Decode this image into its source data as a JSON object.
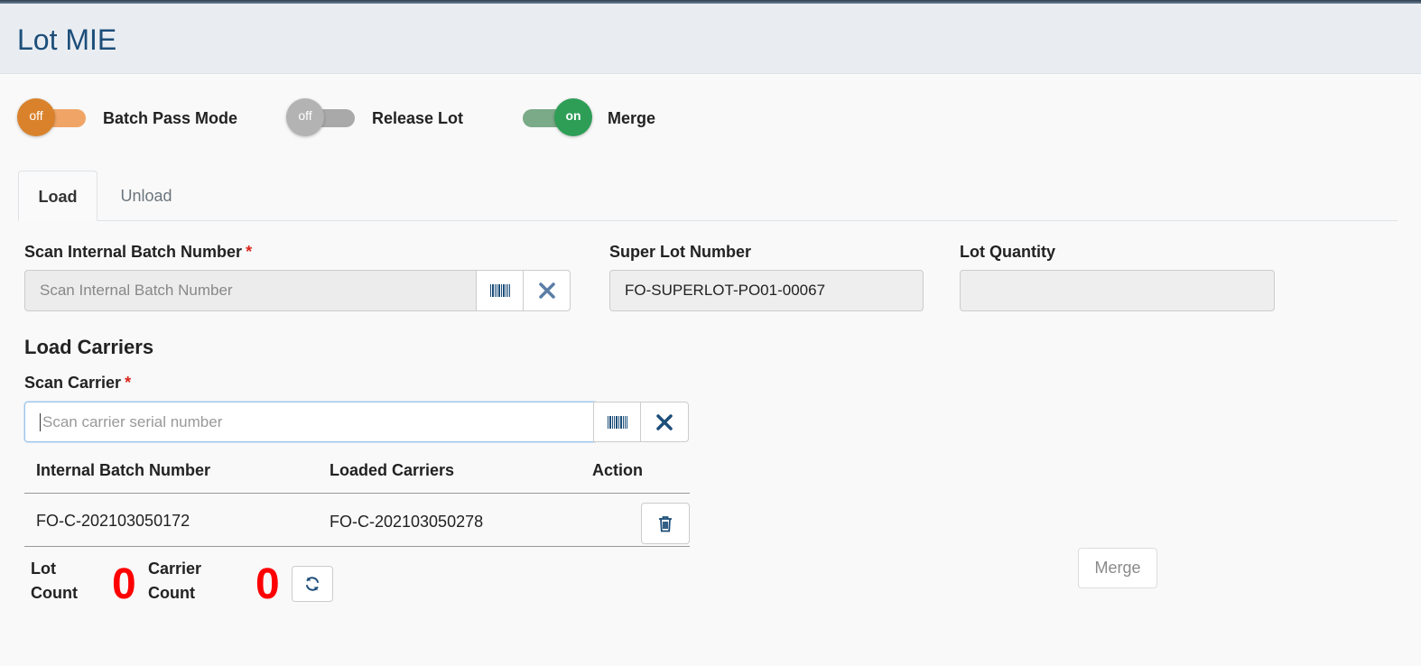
{
  "app": {
    "title": "Lot MIE"
  },
  "toggles": [
    {
      "label": "Batch Pass Mode",
      "state": "off",
      "color": "#d9822b"
    },
    {
      "label": "Release Lot",
      "state": "off",
      "color": "#aaaaaa"
    },
    {
      "label": "Merge",
      "state": "on",
      "color": "#2e9e57"
    }
  ],
  "tabs": [
    {
      "label": "Load",
      "active": true
    },
    {
      "label": "Unload",
      "active": false
    }
  ],
  "form": {
    "batch_number": {
      "label": "Scan Internal Batch Number",
      "required_mark": "*",
      "placeholder": "Scan Internal Batch Number",
      "value": ""
    },
    "super_lot": {
      "label": "Super Lot Number",
      "value": "FO-SUPERLOT-PO01-00067"
    },
    "lot_quantity": {
      "label": "Lot Quantity",
      "value": ""
    }
  },
  "load_carriers": {
    "title": "Load Carriers",
    "scan_carrier": {
      "label": "Scan Carrier",
      "required_mark": "*",
      "placeholder": "Scan carrier serial number",
      "value": ""
    }
  },
  "table": {
    "columns": [
      "Internal Batch Number",
      "Loaded Carriers",
      "Action"
    ],
    "rows": [
      {
        "batch": "FO-C-202103050172",
        "carrier": "FO-C-202103050278"
      }
    ]
  },
  "counts": {
    "lot_label_line1": "Lot",
    "lot_label_line2": "Count",
    "lot_value": "0",
    "carrier_label_line1": "Carrier",
    "carrier_label_line2": "Count",
    "carrier_value": "0"
  },
  "actions": {
    "merge_label": "Merge"
  },
  "colors": {
    "accent": "#1d4e7a",
    "count": "#ff0000",
    "required": "#d9261c"
  },
  "icons": [
    "barcode-icon",
    "clear-icon",
    "trash-icon",
    "refresh-icon"
  ]
}
